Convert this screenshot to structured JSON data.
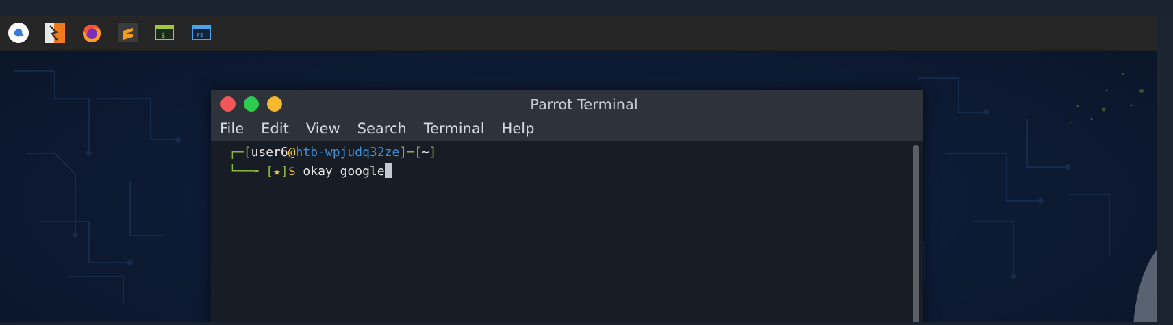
{
  "panel": {
    "launchers": [
      {
        "icon": "parrot-menu-icon"
      },
      {
        "icon": "parrot-launcher-icon"
      },
      {
        "icon": "firefox-icon"
      },
      {
        "icon": "sublime-text-icon"
      },
      {
        "icon": "terminal-icon",
        "glyph": "$"
      },
      {
        "icon": "powershell-icon",
        "glyph": "PS"
      }
    ]
  },
  "window": {
    "title": "Parrot Terminal",
    "menu": [
      "File",
      "Edit",
      "View",
      "Search",
      "Terminal",
      "Help"
    ]
  },
  "terminal": {
    "corner_top": "┌─",
    "bracket_open": "[",
    "user": "user6",
    "at": "@",
    "host": "htb-wpjudq32ze",
    "mid": "]─[",
    "cwd": "~",
    "bracket_close": "]",
    "corner_bottom": "└──╼ ",
    "star_open": "[",
    "star": "★",
    "star_close": "]",
    "prompt": "$",
    "command": " okay google"
  },
  "colors": {
    "close": "#f25656",
    "maximize": "#2fcb4f",
    "minimize": "#f5b82e",
    "prompt_green": "#8ab83f",
    "host_blue": "#3d8fd6",
    "star_yellow": "#f2c43a",
    "user_white": "#e8e8e8"
  }
}
